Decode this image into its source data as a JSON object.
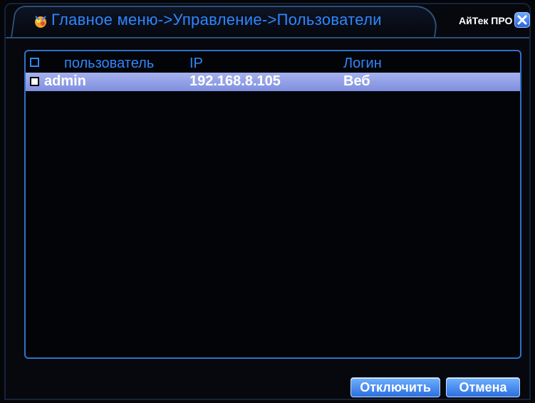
{
  "title_bar": {
    "title": "Главное меню->Управление->Пользователи",
    "brand": "АйТек ПРО",
    "app_icon": "dvr-app-icon",
    "close_icon": "close-icon"
  },
  "table": {
    "columns": {
      "user": "пользователь",
      "ip": "IP",
      "login": "Логин"
    },
    "rows": [
      {
        "user": "admin",
        "ip": "192.168.8.105",
        "login": "Веб",
        "selected": true
      }
    ]
  },
  "buttons": {
    "disconnect": "Отключить",
    "cancel": "Отмена"
  },
  "colors": {
    "accent": "#2f86ff",
    "row_highlight": "#8f9ce6",
    "button": "#3d82f0",
    "background": "#05060a"
  }
}
